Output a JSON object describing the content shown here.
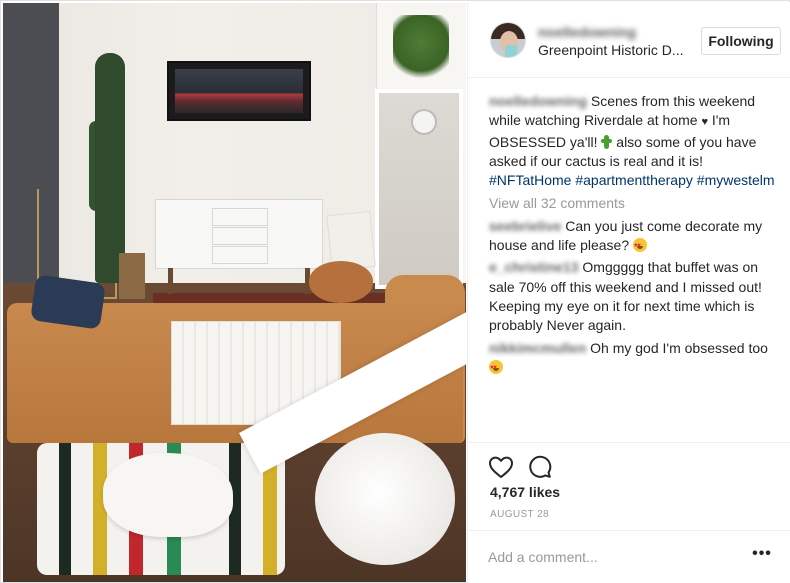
{
  "header": {
    "username": "noelledowning",
    "location": "Greenpoint Historic D...",
    "follow_label": "Following"
  },
  "caption": {
    "username": "noelledowning",
    "text_1": "Scenes from this weekend while watching Riverdale at home ",
    "text_2": " I'm OBSESSED ya'll! ",
    "text_3": " also some of you have asked if our cactus is real and it is! ",
    "hashtags": [
      "#NFTatHome",
      "#apartmenttherapy",
      "#mywestelm"
    ]
  },
  "view_all_label": "View all 32 comments",
  "comments": [
    {
      "username": "seebrielive",
      "text": "Can you just come decorate my house and life please? "
    },
    {
      "username": "e_christine13",
      "text": "Omggggg that buffet was on sale 70% off this weekend and I missed out! Keeping my eye on it for next time which is probably Never again."
    },
    {
      "username": "nikkimcmullen",
      "text": "Oh my god I'm obsessed too "
    }
  ],
  "likes_label": "4,767 likes",
  "date_label": "AUGUST 28",
  "add_comment": {
    "placeholder": "Add a comment..."
  },
  "more_label": "•••",
  "icons": {
    "like": "heart-outline-icon",
    "comment": "speech-bubble-icon",
    "more": "ellipsis-icon",
    "small_heart": "black-heart",
    "emoji_cactus": "cactus-emoji",
    "emoji_heart_eyes": "heart-eyes-emoji"
  },
  "colors": {
    "text": "#262626",
    "muted": "#999999",
    "hashtag": "#003569",
    "border": "#efefef"
  }
}
